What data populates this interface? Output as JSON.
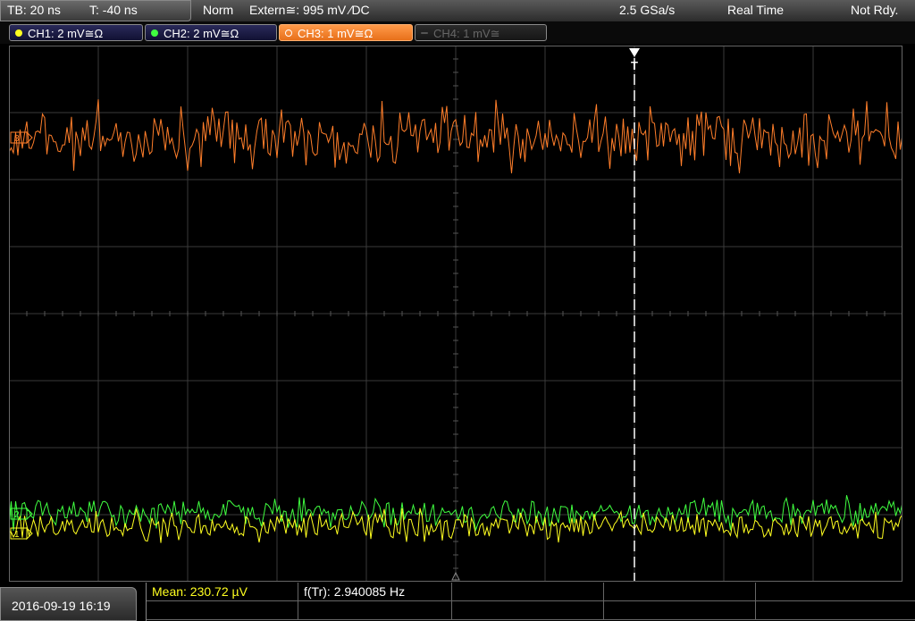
{
  "topbar": {
    "timebase": "TB: 20 ns",
    "trigger_time": "T: -40 ns",
    "mode": "Norm",
    "trigger_info": "Extern≅: 995 mV ⁄DC",
    "sample_rate": "2.5 GSa/s",
    "acq_mode": "Real Time",
    "status": "Not Rdy."
  },
  "channels": [
    {
      "label": "CH1: 2 mV≅Ω",
      "color": "#ffff20",
      "state": "on"
    },
    {
      "label": "CH2: 2 mV≅Ω",
      "color": "#40ff40",
      "state": "on"
    },
    {
      "label": "CH3: 1 mV≅Ω",
      "color": "#ff7e2a",
      "state": "active"
    },
    {
      "label": "CH4: 1 mV≅",
      "color": "#777777",
      "state": "off"
    }
  ],
  "trigger_marker": "T",
  "markers": {
    "ch1": "1",
    "ch2": "2",
    "ch3": "3"
  },
  "bottombar": {
    "datetime": "2016-09-19 16:19",
    "measurements": [
      {
        "label": "Mean: 230.72 µV",
        "color": "#ffff20"
      },
      {
        "label": "f(Tr): 2.940085 Hz",
        "color": "#ffffff"
      }
    ]
  },
  "colors": {
    "ch1": "#ffff20",
    "ch2": "#40ff40",
    "ch3": "#ff7e2a",
    "grid": "#3a3a3a"
  }
}
